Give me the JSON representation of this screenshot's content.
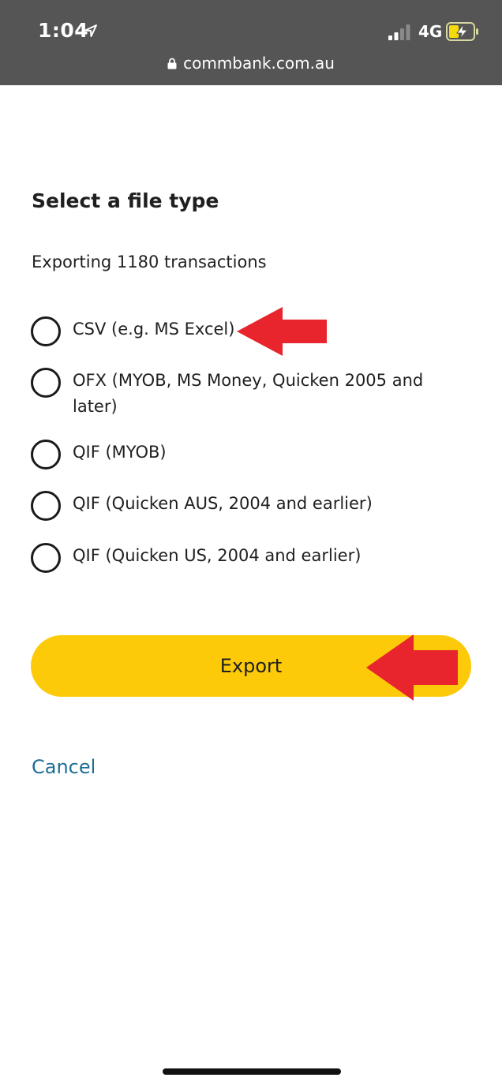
{
  "status_bar": {
    "time": "1:04",
    "network": "4G",
    "url": "commbank.com.au",
    "icons": [
      "location-arrow-icon",
      "signal-bars-icon",
      "battery-charging-icon",
      "lock-icon"
    ]
  },
  "dialog": {
    "title": "Select a file type",
    "subtitle": "Exporting 1180 transactions",
    "options": [
      {
        "label": "CSV (e.g. MS Excel)",
        "selected": false
      },
      {
        "label": "OFX (MYOB, MS Money, Quicken 2005 and later)",
        "selected": false
      },
      {
        "label": "QIF (MYOB)",
        "selected": false
      },
      {
        "label": "QIF (Quicken AUS, 2004 and earlier)",
        "selected": false
      },
      {
        "label": "QIF (Quicken US, 2004 and earlier)",
        "selected": false
      }
    ],
    "export_label": "Export",
    "cancel_label": "Cancel"
  },
  "colors": {
    "status_bar_bg": "#555555",
    "export_button_bg": "#fdca0a",
    "cancel_link": "#1d6d95",
    "annotation_arrow": "#e8242c",
    "battery_fill": "#f5d90a"
  }
}
